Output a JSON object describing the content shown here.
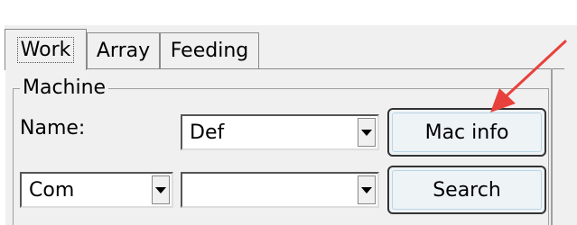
{
  "tabs": [
    {
      "label": "Work",
      "active": true
    },
    {
      "label": "Array",
      "active": false
    },
    {
      "label": "Feeding",
      "active": false
    }
  ],
  "machine_group": {
    "title": "Machine",
    "name_label": "Name:",
    "name_value": "Def",
    "port_value": "Com",
    "port_detail_value": "",
    "mac_info_label": "Mac info",
    "search_label": "Search"
  },
  "annotation": {
    "arrow_color": "#e8413c"
  }
}
